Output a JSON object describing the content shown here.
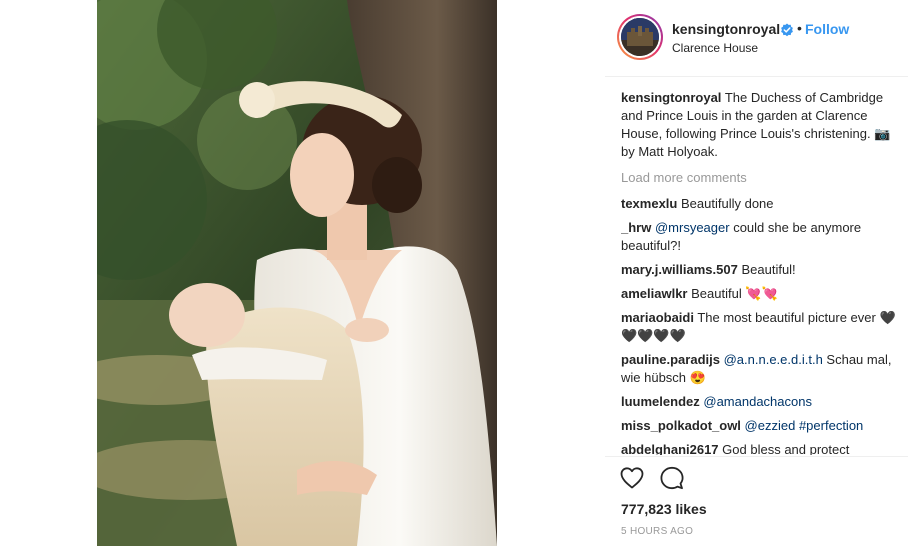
{
  "post": {
    "username": "kensingtonroyal",
    "follow_label": "Follow",
    "separator": "•",
    "location": "Clarence House",
    "caption": "The Duchess of Cambridge and Prince Louis in the garden at Clarence House, following Prince Louis's christening. 📷 by Matt Holyoak.",
    "load_more": "Load more comments",
    "likes": "777,823 likes",
    "timestamp": "5 HOURS AGO"
  },
  "comments": [
    {
      "user": "texmexlu",
      "parts": [
        {
          "t": "Beautifully done",
          "mention": false
        }
      ]
    },
    {
      "user": "_hrw",
      "parts": [
        {
          "t": "@mrsyeager",
          "mention": true
        },
        {
          "t": " could she be anymore beautiful?!",
          "mention": false
        }
      ]
    },
    {
      "user": "mary.j.williams.507",
      "parts": [
        {
          "t": "Beautiful!",
          "mention": false
        }
      ]
    },
    {
      "user": "ameliawlkr",
      "parts": [
        {
          "t": "Beautiful 💘💘",
          "mention": false
        }
      ]
    },
    {
      "user": "mariaobaidi",
      "parts": [
        {
          "t": "The most beautiful picture ever 🖤🖤🖤🖤🖤",
          "mention": false
        }
      ]
    },
    {
      "user": "pauline.paradijs",
      "parts": [
        {
          "t": "@a.n.n.e.e.d.i.t.h",
          "mention": true
        },
        {
          "t": " Schau mal, wie hübsch 😍",
          "mention": false
        }
      ]
    },
    {
      "user": "luumelendez",
      "parts": [
        {
          "t": "@amandachacons",
          "mention": true
        }
      ]
    },
    {
      "user": "miss_polkadot_owl",
      "parts": [
        {
          "t": "@ezzied",
          "mention": true
        },
        {
          "t": " ",
          "mention": false
        },
        {
          "t": "#perfection",
          "mention": true
        }
      ]
    },
    {
      "user": "abdelghani2617",
      "parts": [
        {
          "t": "God bless and protect",
          "mention": false
        }
      ]
    }
  ],
  "icons": {
    "verified": "verified-badge-icon",
    "like": "heart-icon",
    "comment": "speech-bubble-icon"
  },
  "colors": {
    "link": "#3897f0",
    "mention": "#003569",
    "muted": "#999999",
    "text": "#262626"
  }
}
